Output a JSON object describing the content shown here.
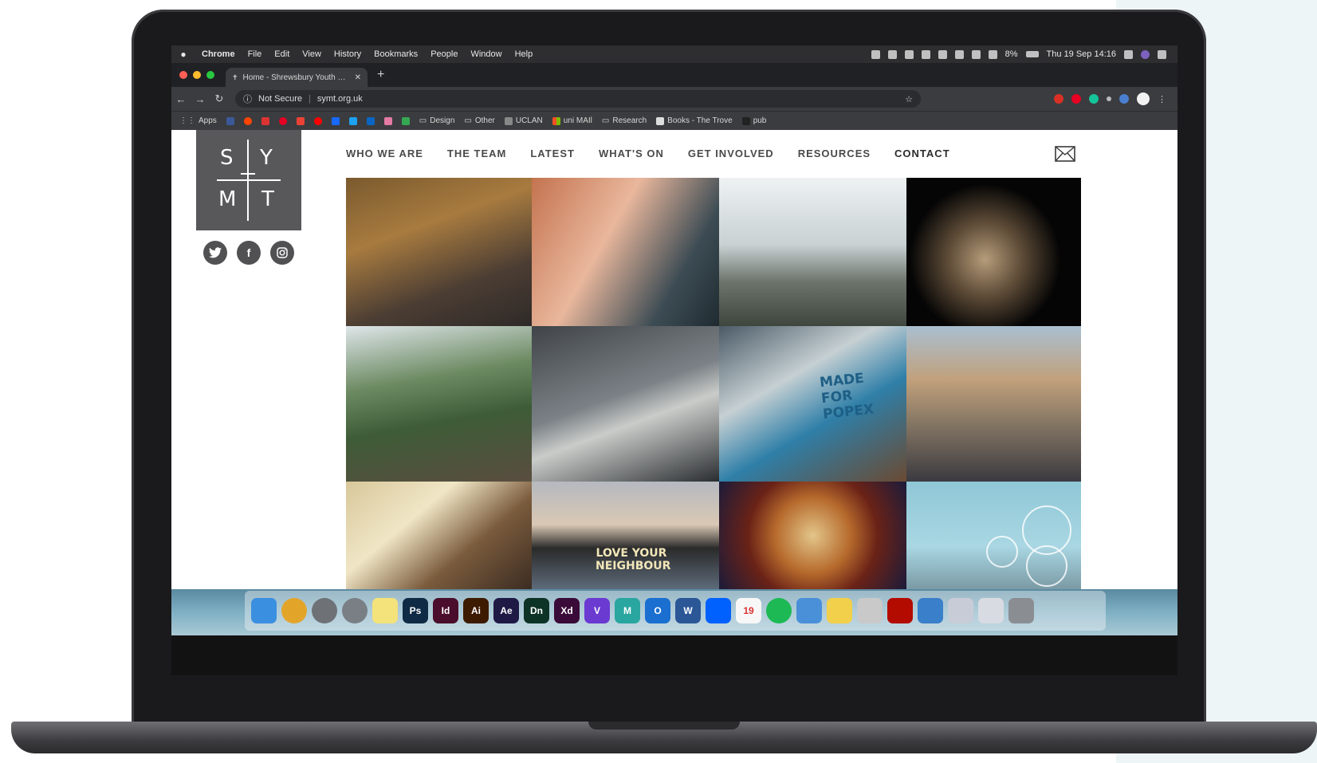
{
  "menubar": {
    "app": "Chrome",
    "menus": [
      "File",
      "Edit",
      "View",
      "History",
      "Bookmarks",
      "People",
      "Window",
      "Help"
    ],
    "battery": "8%",
    "clock": "Thu 19 Sep 14:16"
  },
  "browser": {
    "tab_title": "Home - Shrewsbury Youth Mi...",
    "security_label": "Not Secure",
    "url": "symt.org.uk",
    "bookmarks": [
      "Apps",
      "Design",
      "Other",
      "UCLAN",
      "uni MAIl",
      "Research",
      "Books - The Trove",
      "pub"
    ]
  },
  "site": {
    "logo": {
      "tl": "S",
      "tr": "Y",
      "bl": "M",
      "br": "T"
    },
    "nav": [
      "WHO WE ARE",
      "THE TEAM",
      "LATEST",
      "WHAT'S ON",
      "GET INVOLVED",
      "RESOURCES",
      "CONTACT"
    ],
    "socials": [
      "twitter-icon",
      "facebook-icon",
      "instagram-icon"
    ],
    "tiles": [
      {
        "name": "congregation-photo",
        "bg": "linear-gradient(160deg,#7a5a2e,#a87b3f 35%,#4b3d33 70%,#2e2a28)"
      },
      {
        "name": "praying-woman-photo",
        "bg": "linear-gradient(120deg,#c4734f,#e9b79c 40%,#3d4c54 75%,#1f2b31)"
      },
      {
        "name": "mountain-joy-photo",
        "bg": "linear-gradient(180deg,#eef2f3,#c9d1d3 45%,#6d746c 70%,#3f463e)"
      },
      {
        "name": "eucharist-photo",
        "bg": "radial-gradient(circle at 45% 55%,#b59c7a,#5c4a36 30%,#050505 60%)"
      },
      {
        "name": "friends-hillside-photo",
        "bg": "linear-gradient(170deg,#dfe6ea,#6d8b63 35%,#3e5c37 60%,#5a4d40)"
      },
      {
        "name": "open-bible-photo",
        "bg": "linear-gradient(160deg,#404448,#7b8186 45%,#c9ccc9 60%,#2a2d30)"
      },
      {
        "name": "made-for-popex-photo",
        "bg": "linear-gradient(150deg,#4a5a66,#c6d0d3 35%,#2f7fa8 60%,#6a4a32)"
      },
      {
        "name": "bishop-group-photo",
        "bg": "linear-gradient(180deg,#a9bfd0,#c1a07b 35%,#8a7a66 60%,#3b3a40)"
      },
      {
        "name": "mitre-bishop-photo",
        "bg": "linear-gradient(140deg,#d8c79a,#f0e6c6 35%,#7a5b3c 65%,#3b2c22)"
      },
      {
        "name": "love-your-neighbour-photo",
        "bg": "linear-gradient(180deg,#b5b9c0,#d9c8b4 40%,#2a2a2a 62%,#5d6b7a)"
      },
      {
        "name": "stained-glass-photo",
        "bg": "radial-gradient(circle at 50% 50%,#e3c58a,#b66a2c 35%,#6a2217 60%,#1b1b3a)"
      },
      {
        "name": "pope-logo-photo",
        "bg": "linear-gradient(180deg,#8fc7d6,#a9d7e3 60%,#7a9aa5)"
      }
    ],
    "tile_captions": {
      "popex": "MADE FOR POPEX",
      "neighbour": "LOVE YOUR NEIGHBOUR"
    },
    "fab_label": "↑"
  },
  "dock": {
    "apps": [
      {
        "name": "finder",
        "label": "",
        "color": "#3b8fe0"
      },
      {
        "name": "chrome",
        "label": "",
        "color": "#e2a52a"
      },
      {
        "name": "system-preferences",
        "label": "",
        "color": "#6e7277"
      },
      {
        "name": "launchpad",
        "label": "",
        "color": "#7a7f86"
      },
      {
        "name": "notes",
        "label": "",
        "color": "#f4e27a"
      },
      {
        "name": "photoshop",
        "label": "Ps",
        "color": "#0f2a44"
      },
      {
        "name": "indesign",
        "label": "Id",
        "color": "#4a0d2b"
      },
      {
        "name": "illustrator",
        "label": "Ai",
        "color": "#3d1b00"
      },
      {
        "name": "after-effects",
        "label": "Ae",
        "color": "#1f1a45"
      },
      {
        "name": "dimension",
        "label": "Dn",
        "color": "#0d3327"
      },
      {
        "name": "xd",
        "label": "Xd",
        "color": "#3a0b38"
      },
      {
        "name": "vectornator",
        "label": "V",
        "color": "#6a3ad1"
      },
      {
        "name": "m-app",
        "label": "M",
        "color": "#2aa6a0"
      },
      {
        "name": "outlook",
        "label": "O",
        "color": "#1a6fd0"
      },
      {
        "name": "word",
        "label": "W",
        "color": "#2b5797"
      },
      {
        "name": "dropbox",
        "label": "",
        "color": "#0061fe"
      },
      {
        "name": "calendar",
        "label": "19",
        "color": "#f7f7f7"
      },
      {
        "name": "spotify",
        "label": "",
        "color": "#1db954"
      },
      {
        "name": "keynote",
        "label": "",
        "color": "#4a90d9"
      },
      {
        "name": "stickies",
        "label": "",
        "color": "#f2d04b"
      },
      {
        "name": "preview",
        "label": "",
        "color": "#c9c9c9"
      },
      {
        "name": "acrobat",
        "label": "",
        "color": "#b30b00"
      },
      {
        "name": "network-utility",
        "label": "",
        "color": "#3a7fc9"
      },
      {
        "name": "downloads",
        "label": "",
        "color": "#c8ccd6"
      },
      {
        "name": "documents",
        "label": "",
        "color": "#d8dce2"
      },
      {
        "name": "trash",
        "label": "",
        "color": "#8a8e93"
      }
    ]
  }
}
